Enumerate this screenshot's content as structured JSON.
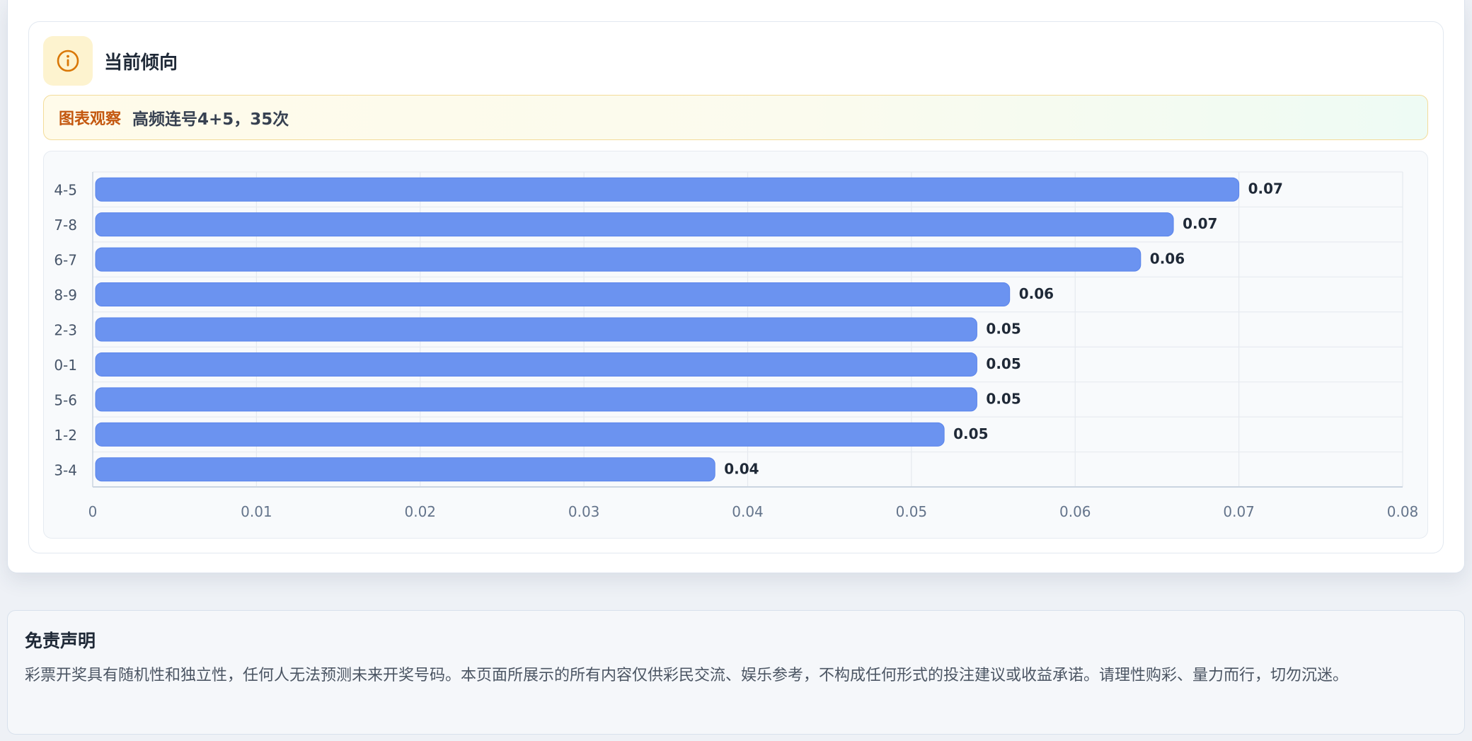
{
  "trend": {
    "title": "当前倾向",
    "observation_label": "图表观察",
    "observation_text": "高频连号4+5，35次"
  },
  "disclaimer": {
    "title": "免责声明",
    "text": "彩票开奖具有随机性和独立性，任何人无法预测未来开奖号码。本页面所展示的所有内容仅供彩民交流、娱乐参考，不构成任何形式的投注建议或收益承诺。请理性购彩、量力而行，切勿沉迷。"
  },
  "colors": {
    "bar": "#6b93f0",
    "accent": "#d97706",
    "observation_label": "#c4580f"
  },
  "icons": {
    "header": "info-circle-icon"
  },
  "chart_data": {
    "type": "bar",
    "orientation": "horizontal",
    "categories": [
      "4-5",
      "7-8",
      "6-7",
      "8-9",
      "2-3",
      "0-1",
      "5-6",
      "1-2",
      "3-4"
    ],
    "values": [
      0.07,
      0.066,
      0.064,
      0.056,
      0.054,
      0.054,
      0.054,
      0.052,
      0.038
    ],
    "value_labels": [
      "0.07",
      "0.07",
      "0.06",
      "0.06",
      "0.05",
      "0.05",
      "0.05",
      "0.05",
      "0.04"
    ],
    "xlim": [
      0,
      0.08
    ],
    "x_ticks": [
      "0",
      "0.01",
      "0.02",
      "0.03",
      "0.04",
      "0.05",
      "0.06",
      "0.07",
      "0.08"
    ],
    "grid": true,
    "legend": "none"
  }
}
